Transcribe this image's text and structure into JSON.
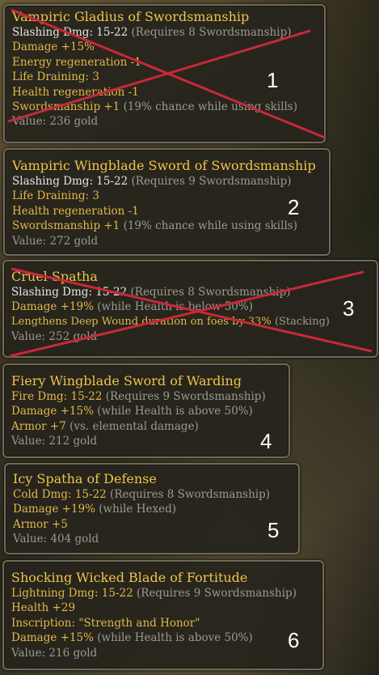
{
  "items": [
    {
      "name": "Vampiric Gladius of Swordsmanship",
      "damage_type": "Slashing Dmg:",
      "damage_range": "15-22",
      "requirement": "(Requires 8 Swordsmanship)",
      "mods": [
        {
          "text": "Damage +15%",
          "note": ""
        },
        {
          "text": "Energy regeneration -1",
          "note": ""
        },
        {
          "text": "Life Draining: 3",
          "note": ""
        },
        {
          "text": "Health regeneration -1",
          "note": ""
        },
        {
          "text": "Swordsmanship +1",
          "note": "(19% chance while using skills)"
        }
      ],
      "value": "Value: 236 gold",
      "number": "1",
      "crossed_out": true
    },
    {
      "name": "Vampiric Wingblade Sword of Swordsmanship",
      "damage_type": "Slashing Dmg:",
      "damage_range": "15-22",
      "requirement": "(Requires 9 Swordsmanship)",
      "mods": [
        {
          "text": "Life Draining: 3",
          "note": ""
        },
        {
          "text": "Health regeneration -1",
          "note": ""
        },
        {
          "text": "Swordsmanship +1",
          "note": "(19% chance while using skills)"
        }
      ],
      "value": "Value: 272 gold",
      "number": "2",
      "crossed_out": false
    },
    {
      "name": "Cruel Spatha",
      "damage_type": "Slashing Dmg:",
      "damage_range": "15-22",
      "requirement": "(Requires 8 Swordsmanship)",
      "mods": [
        {
          "text": "Damage +19%",
          "note": "(while Health is below 50%)"
        },
        {
          "text": "Lengthens Deep Wound duration on foes by 33%",
          "note": "(Stacking)"
        }
      ],
      "value": "Value: 252 gold",
      "number": "3",
      "crossed_out": true
    },
    {
      "name": "Fiery Wingblade Sword of Warding",
      "damage_type": "Fire Dmg:",
      "damage_range": "15-22",
      "requirement": "(Requires 9 Swordsmanship)",
      "mods": [
        {
          "text": "Damage +15%",
          "note": "(while Health is above 50%)"
        },
        {
          "text": "Armor +7",
          "note": "(vs. elemental damage)"
        }
      ],
      "value": "Value: 212 gold",
      "number": "4",
      "crossed_out": false
    },
    {
      "name": "Icy Spatha of Defense",
      "damage_type": "Cold Dmg:",
      "damage_range": "15-22",
      "requirement": "(Requires 8 Swordsmanship)",
      "mods": [
        {
          "text": "Damage +19%",
          "note": "(while Hexed)"
        },
        {
          "text": "Armor +5",
          "note": ""
        }
      ],
      "value": "Value: 404 gold",
      "number": "5",
      "crossed_out": false
    },
    {
      "name": "Shocking Wicked Blade of Fortitude",
      "damage_type": "Lightning Dmg:",
      "damage_range": "15-22",
      "requirement": "(Requires 9 Swordsmanship)",
      "mods": [
        {
          "text": "Health +29",
          "note": ""
        },
        {
          "text": "Inscription: \"Strength and Honor\"",
          "note": ""
        },
        {
          "text": "Damage +15%",
          "note": "(while Health is above 50%)"
        }
      ],
      "value": "Value: 216 gold",
      "number": "6",
      "crossed_out": false
    }
  ],
  "colors": {
    "title": "#f0c44a",
    "stat_white": "#e6e6e6",
    "mod_yellow": "#e2b84a",
    "note_gray": "#9c9a90",
    "cross_red": "#c8283a",
    "panel_bg": "#26241c",
    "panel_border": "#6f6a58"
  }
}
